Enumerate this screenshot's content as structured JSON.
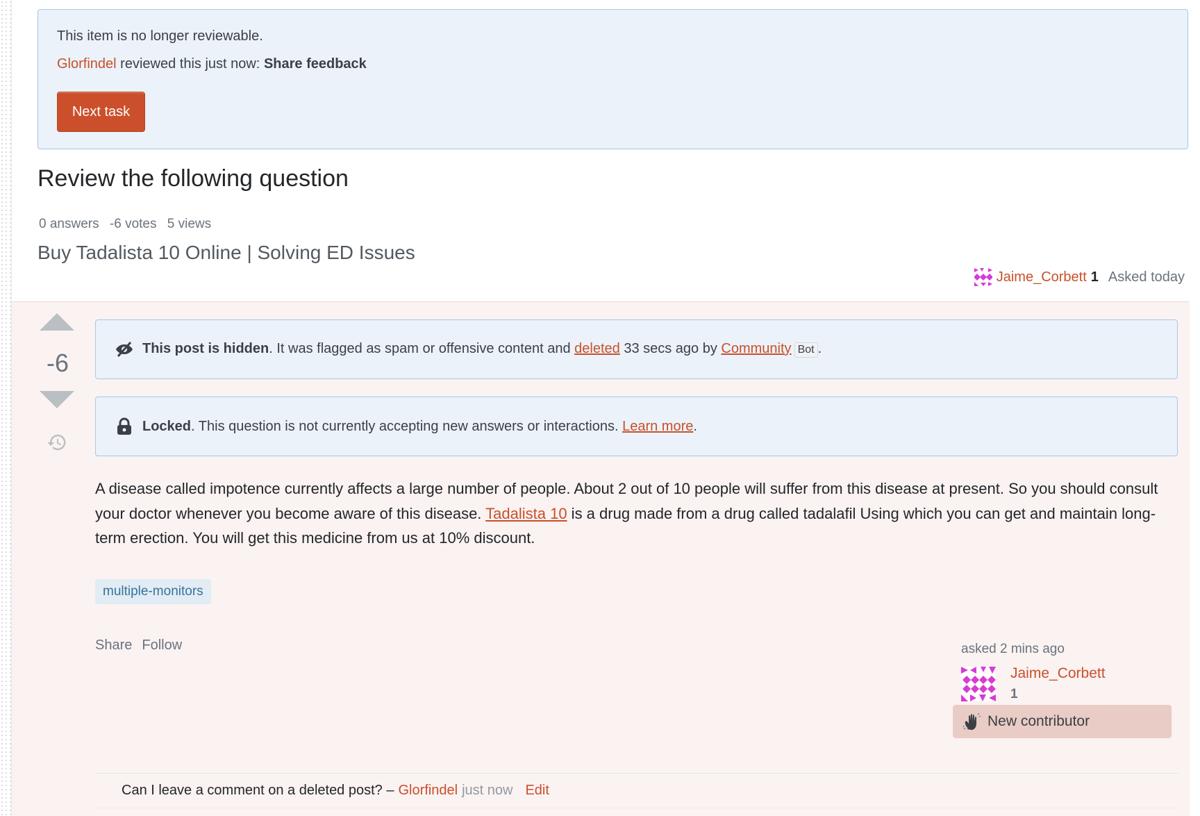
{
  "review_status": {
    "not_reviewable": "This item is no longer reviewable.",
    "reviewer": "Glorfindel",
    "reviewed_text": " reviewed this just now: ",
    "feedback_label": "Share feedback",
    "next_task_label": "Next task"
  },
  "page": {
    "heading": "Review the following question"
  },
  "question": {
    "stats": {
      "answers": "0 answers",
      "votes": "-6 votes",
      "views": "5 views"
    },
    "title": "Buy Tadalista 10 Online | Solving ED Issues",
    "owner": {
      "name": "Jaime_Corbett",
      "reputation": "1",
      "asked_label": "Asked today"
    },
    "vote_count": "-6",
    "notices": {
      "hidden": {
        "bold": "This post is hidden",
        "text1": ". It was flagged as spam or offensive content and ",
        "link_deleted": "deleted",
        "text2": " 33 secs ago by ",
        "link_user": "Community",
        "badge": "Bot",
        "end": "."
      },
      "locked": {
        "bold": "Locked",
        "text": ". This question is not currently accepting new answers or interactions. ",
        "link": "Learn more",
        "end": "."
      }
    },
    "body": {
      "part1": "A disease called impotence currently affects a large number of people. About 2 out of 10 people will suffer from this disease at present. So you should consult your doctor whenever you become aware of this disease. ",
      "link": "Tadalista 10",
      "part2": " is a drug made from a drug called tadalafil Using which you can get and maintain long-term erection. You will get this medicine from us at 10% discount."
    },
    "tags": [
      "multiple-monitors"
    ],
    "menu": {
      "share": "Share",
      "follow": "Follow"
    },
    "user_card": {
      "asked_time": "asked 2 mins ago",
      "name": "Jaime_Corbett",
      "reputation": "1",
      "new_contributor": "New contributor"
    },
    "comment": {
      "text": "Can I leave a comment on a deleted post? –",
      "user": "Glorfindel",
      "time": "just now",
      "edit": "Edit"
    }
  },
  "colors": {
    "accent": "#cc4f2c",
    "link": "#c9502b",
    "notice_bg": "#ebf2fa",
    "deleted_bg": "#fbf2f2",
    "new_contributor_bg": "#e9ccc5",
    "tag_bg": "#e1ecf4",
    "tag_text": "#39739d"
  }
}
